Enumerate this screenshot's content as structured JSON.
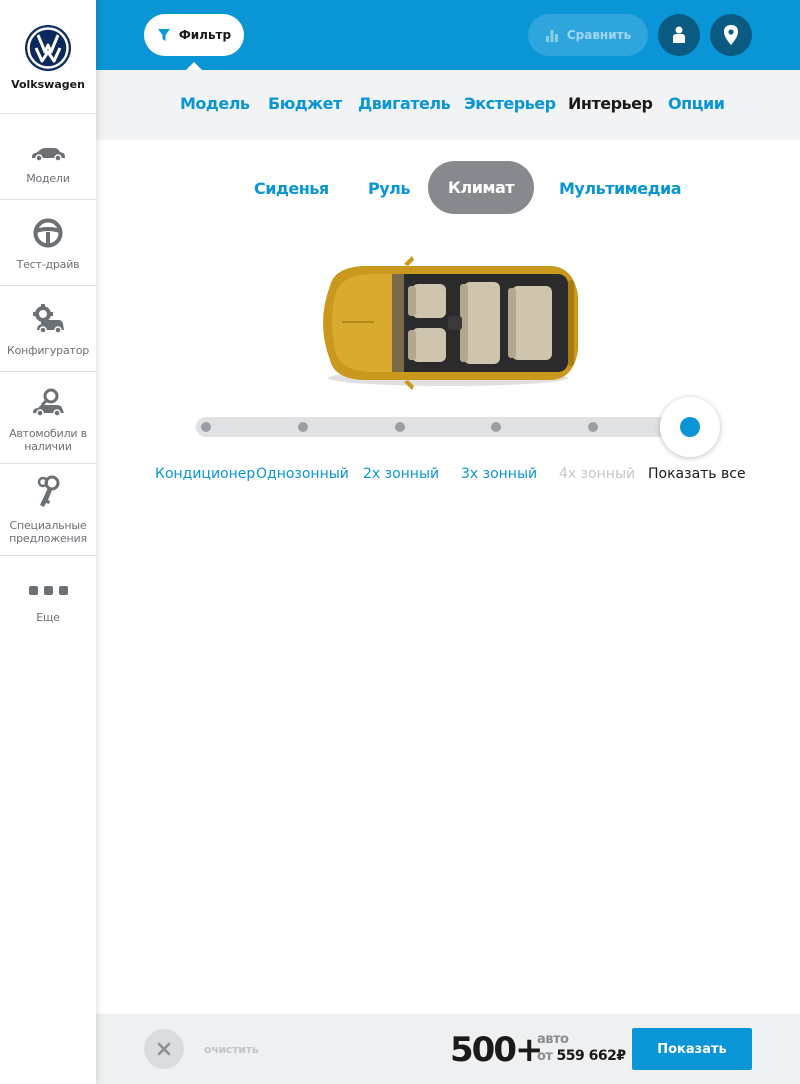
{
  "brand": {
    "name": "Volkswagen",
    "logo": "vw-logo"
  },
  "sidebar": {
    "items": [
      {
        "label": "Модели",
        "icon": "car-icon"
      },
      {
        "label": "Тест-драйв",
        "icon": "steering-wheel-icon"
      },
      {
        "label": "Конфигуратор",
        "icon": "configurator-gear-car-icon"
      },
      {
        "label": "Автомобили в наличии",
        "icon": "car-search-icon"
      },
      {
        "label": "Специальные предложения",
        "icon": "keys-icon"
      },
      {
        "label": "Еще",
        "icon": "more-dots-icon"
      }
    ]
  },
  "topbar": {
    "filter_label": "Фильтр",
    "compare_label": "Сравнить",
    "user_icon": "user-icon",
    "location_icon": "location-pin-icon"
  },
  "categories": {
    "items": [
      "Модель",
      "Бюджет",
      "Двигатель",
      "Экстерьер",
      "Интерьер",
      "Опции"
    ],
    "active": "Интерьер"
  },
  "subtabs": {
    "items": [
      "Сиденья",
      "Руль",
      "Климат",
      "Мультимедиа"
    ],
    "active": "Климат"
  },
  "climate_slider": {
    "options": [
      "Кондиционер",
      "Однозонный",
      "2х зонный",
      "3х зонный",
      "4х зонный",
      "Показать все"
    ],
    "disabled": [
      "4х зонный"
    ],
    "selected": "Показать все"
  },
  "footer": {
    "clear_label": "очистить",
    "count": "500+",
    "count_unit": "авто",
    "price_prefix": "от",
    "price_value": "559 662₽",
    "show_label": "Показать"
  },
  "colors": {
    "accent": "#0a96d6",
    "dark_button": "#0a5a82",
    "car_body": "#c9981c"
  }
}
